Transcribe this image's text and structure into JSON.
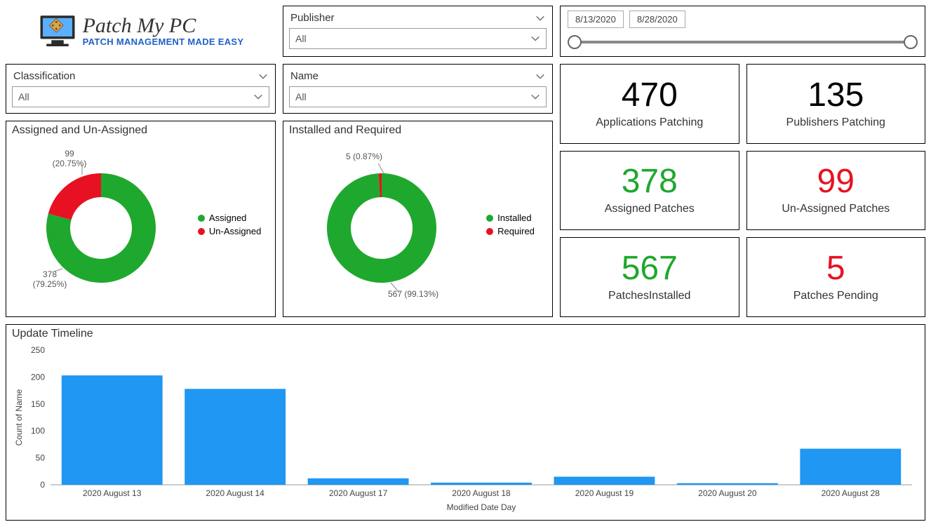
{
  "brand": {
    "name": "Patch My PC",
    "tagline": "PATCH MANAGEMENT MADE EASY"
  },
  "filters": {
    "classification": {
      "label": "Classification",
      "value": "All"
    },
    "publisher": {
      "label": "Publisher",
      "value": "All"
    },
    "name": {
      "label": "Name",
      "value": "All"
    }
  },
  "date_range": {
    "from": "8/13/2020",
    "to": "8/28/2020"
  },
  "kpis": {
    "apps_patching": {
      "value": "470",
      "label": "Applications Patching",
      "color": ""
    },
    "pubs_patching": {
      "value": "135",
      "label": "Publishers Patching",
      "color": ""
    },
    "assigned": {
      "value": "378",
      "label": "Assigned Patches",
      "color": "green"
    },
    "unassigned": {
      "value": "99",
      "label": "Un-Assigned Patches",
      "color": "red"
    },
    "installed": {
      "value": "567",
      "label": "PatchesInstalled",
      "color": "green"
    },
    "pending": {
      "value": "5",
      "label": "Patches Pending",
      "color": "red"
    }
  },
  "donut_assigned": {
    "title": "Assigned and Un-Assigned",
    "legend": [
      "Assigned",
      "Un-Assigned"
    ],
    "label_assigned": "378\n(79.25%)",
    "label_unassigned": "99\n(20.75%)"
  },
  "donut_installed": {
    "title": "Installed and Required",
    "legend": [
      "Installed",
      "Required"
    ],
    "label_installed": "567 (99.13%)",
    "label_required": "5 (0.87%)"
  },
  "timeline_title": "Update Timeline",
  "timeline_ylabel": "Count of Name",
  "timeline_xlabel": "Modified Date Day",
  "chart_data": [
    {
      "type": "pie",
      "title": "Assigned and Un-Assigned",
      "series": [
        {
          "name": "Assigned",
          "value": 378,
          "pct": 79.25
        },
        {
          "name": "Un-Assigned",
          "value": 99,
          "pct": 20.75
        }
      ]
    },
    {
      "type": "pie",
      "title": "Installed and Required",
      "series": [
        {
          "name": "Installed",
          "value": 567,
          "pct": 99.13
        },
        {
          "name": "Required",
          "value": 5,
          "pct": 0.87
        }
      ]
    },
    {
      "type": "bar",
      "title": "Update Timeline",
      "xlabel": "Modified Date Day",
      "ylabel": "Count of Name",
      "ylim": [
        0,
        250
      ],
      "yticks": [
        0,
        50,
        100,
        150,
        200,
        250
      ],
      "categories": [
        "2020 August 13",
        "2020 August 14",
        "2020 August 17",
        "2020 August 18",
        "2020 August 19",
        "2020 August 20",
        "2020 August 28"
      ],
      "values": [
        203,
        178,
        12,
        4,
        15,
        3,
        67
      ]
    }
  ]
}
